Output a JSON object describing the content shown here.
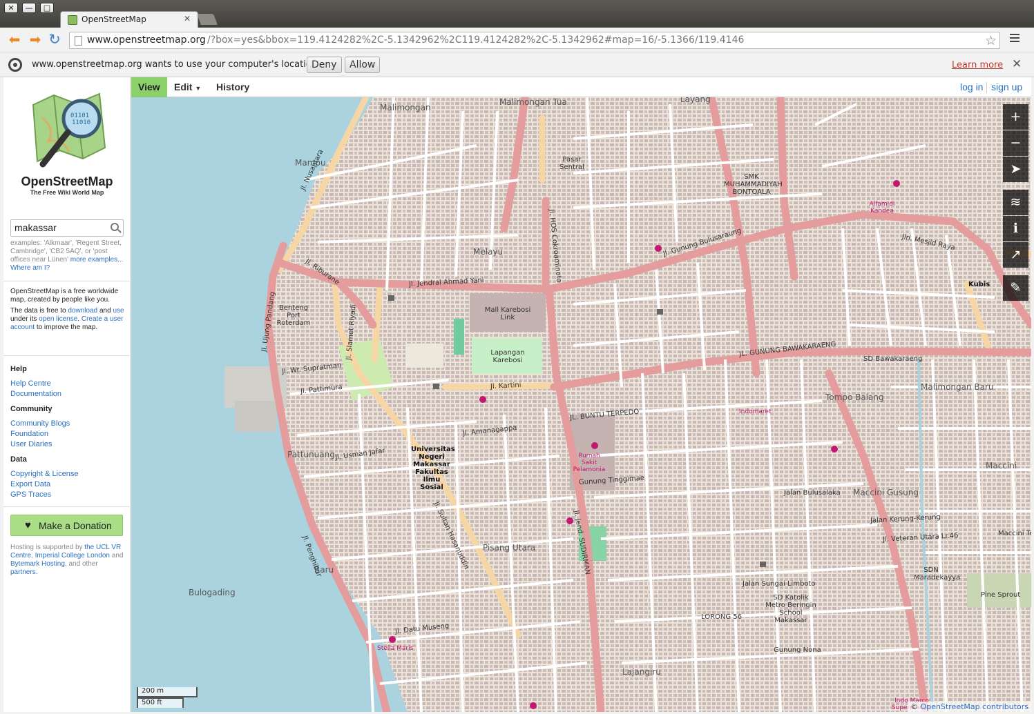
{
  "browser": {
    "tab_title": "OpenStreetMap",
    "url_host": "www.openstreetmap.org",
    "url_rest": "/?box=yes&bbox=119.4124282%2C-5.1342962%2C119.4124282%2C-5.1342962#map=16/-5.1366/119.4146",
    "infobar_text": "www.openstreetmap.org wants to use your computer's location.",
    "deny": "Deny",
    "allow": "Allow",
    "learn_more": "Learn more"
  },
  "sidebar": {
    "site_name": "OpenStreetMap",
    "tagline": "The Free Wiki World Map",
    "search_value": "makassar",
    "search_examples": "examples: 'Alkmaar', 'Regent Street, Cambridge', 'CB2 5AQ', or 'post offices near Lünen'",
    "more_examples": "more examples...",
    "where_am_i": "Where am I?",
    "about_1": "OpenStreetMap is a free worldwide map, created by people like you.",
    "about_2a": "The data is free to",
    "about_download": "download",
    "about_2b": "and",
    "about_use": "use",
    "about_2c": "under its",
    "about_license": "open license",
    "about_create": "Create a user account",
    "about_3": "to improve the map.",
    "help_head": "Help",
    "help_centre": "Help Centre",
    "documentation": "Documentation",
    "community_head": "Community",
    "community_blogs": "Community Blogs",
    "foundation": "Foundation",
    "user_diaries": "User Diaries",
    "data_head": "Data",
    "copyright": "Copyright & License",
    "export": "Export Data",
    "gps": "GPS Traces",
    "donate": "Make a Donation",
    "hosting_1": "Hosting is supported by",
    "hosting_ucl": "the UCL VR Centre",
    "hosting_imperial": "Imperial College London",
    "hosting_and": "and",
    "hosting_bytemark": "Bytemark Hosting",
    "hosting_2": ", and other",
    "hosting_partners": "partners."
  },
  "mapnav": {
    "view": "View",
    "edit": "Edit",
    "history": "History",
    "login": "log in",
    "signup": "sign up"
  },
  "map": {
    "scale_m": "200 m",
    "scale_ft": "500 ft",
    "attribution_prefix": "©",
    "attribution_link": "OpenStreetMap contributors",
    "colors": {
      "land": "#ede3d7",
      "sea": "#aad3df",
      "primary": "#e49c9c",
      "secondary": "#f7d6a5",
      "building": "#c9b9b9",
      "park": "#c8f0c8"
    },
    "labels": [
      {
        "t": "Mampu",
        "c": "place"
      },
      {
        "t": "Malimongan",
        "c": "place"
      },
      {
        "t": "Malimongan Tua",
        "c": "place"
      },
      {
        "t": "Layang",
        "c": "place"
      },
      {
        "t": "Melayu",
        "c": "place"
      },
      {
        "t": "Baru",
        "c": "place"
      },
      {
        "t": "Bulogading",
        "c": "place"
      },
      {
        "t": "Pattunuang",
        "c": "place"
      },
      {
        "t": "Pisang Utara",
        "c": "place"
      },
      {
        "t": "Lajangiru",
        "c": "place"
      },
      {
        "t": "Tompo Balang",
        "c": "place"
      },
      {
        "t": "Maccini Gusung",
        "c": "place"
      },
      {
        "t": "Malimongan Baru",
        "c": "place"
      },
      {
        "t": "Maccini",
        "c": "place"
      },
      {
        "t": "Maccini Tengah",
        "c": ""
      },
      {
        "t": "Benteng Port Roterdam",
        "c": ""
      },
      {
        "t": "Mall Karebosi Link",
        "c": ""
      },
      {
        "t": "Lapangan Karebosi",
        "c": ""
      },
      {
        "t": "Pasar Sentral",
        "c": ""
      },
      {
        "t": "Universitas Negeri Makassar Fakultas Ilmu Sosial",
        "c": "ptitle"
      },
      {
        "t": "Kubis",
        "c": "ptitle"
      },
      {
        "t": "Pine Sprout",
        "c": ""
      },
      {
        "t": "Jl. Jendral Ahmad Yani",
        "c": ""
      },
      {
        "t": "Jl. Gunung Bulusaraung",
        "c": ""
      },
      {
        "t": "JL. GUNUNG BAWAKARAENG",
        "c": ""
      },
      {
        "t": "Jl. Kartini",
        "c": ""
      },
      {
        "t": "Jl. Riburane",
        "c": ""
      },
      {
        "t": "Jl. Slamet Riyadi",
        "c": ""
      },
      {
        "t": "Jl. Sultan Hasanuddin",
        "c": ""
      },
      {
        "t": "Jl. Jend. SUDIRMAN",
        "c": ""
      },
      {
        "t": "Jl. Penghibur",
        "c": ""
      },
      {
        "t": "Jln. Mesjid Raya",
        "c": ""
      },
      {
        "t": "Jl. Nusantara",
        "c": ""
      },
      {
        "t": "JL. BUNTU TERPEDO",
        "c": ""
      },
      {
        "t": "Jl. Ujung Pandang",
        "c": ""
      },
      {
        "t": "Jl. HOS Cokroaminoto",
        "c": ""
      },
      {
        "t": "Rumah Sakit Pelamonia",
        "c": "pink"
      },
      {
        "t": "Stella Maris",
        "c": "pink"
      },
      {
        "t": "Indomaret",
        "c": "pink"
      },
      {
        "t": "Alfamidi Kandea",
        "c": "pink"
      },
      {
        "t": "Indo Marco Supermarket",
        "c": "pink"
      },
      {
        "t": "Jl. Amanagappa",
        "c": ""
      },
      {
        "t": "Jl. Usman Jafar",
        "c": ""
      },
      {
        "t": "Jl. Datu Museng",
        "c": ""
      },
      {
        "t": "Jl. Pattimura",
        "c": ""
      },
      {
        "t": "Jl. Wr. Supratman",
        "c": ""
      },
      {
        "t": "Jalan Bulusalaka",
        "c": ""
      },
      {
        "t": "Gunung Tinggimae",
        "c": ""
      },
      {
        "t": "Jalan Sungai Limboto",
        "c": ""
      },
      {
        "t": "LORONG 56",
        "c": ""
      },
      {
        "t": "Gunung Nona",
        "c": ""
      },
      {
        "t": "Jl. Veteran Utara Lr.46",
        "c": ""
      },
      {
        "t": "Jl. Kartini",
        "c": ""
      },
      {
        "t": "Jalan Kerung-Kerung",
        "c": ""
      },
      {
        "t": "SD Bawakaraeng",
        "c": ""
      },
      {
        "t": "SDN Maradekayya",
        "c": ""
      },
      {
        "t": "SD Katolik Metro Beringin School Makassar",
        "c": ""
      },
      {
        "t": "SMK MUHAMMADIYAH BONTOALA",
        "c": ""
      }
    ]
  }
}
